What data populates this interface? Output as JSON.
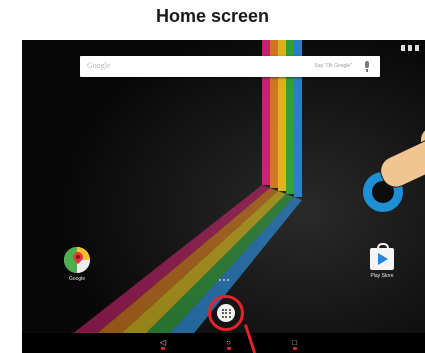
{
  "caption": "Home screen",
  "search": {
    "label": "Google",
    "hint": "Say \"Ok Google\""
  },
  "apps": [
    {
      "label": "Google",
      "icon": "maps-icon"
    },
    {
      "label": "Play Store",
      "icon": "play-store-icon"
    }
  ],
  "navigation": {
    "back_glyph": "◁",
    "home_glyph": "○",
    "recents_glyph": "□"
  },
  "colors": {
    "highlight_red": "#e5232c",
    "touch_blue": "#1e90d6",
    "background": "#0d0d0d"
  }
}
